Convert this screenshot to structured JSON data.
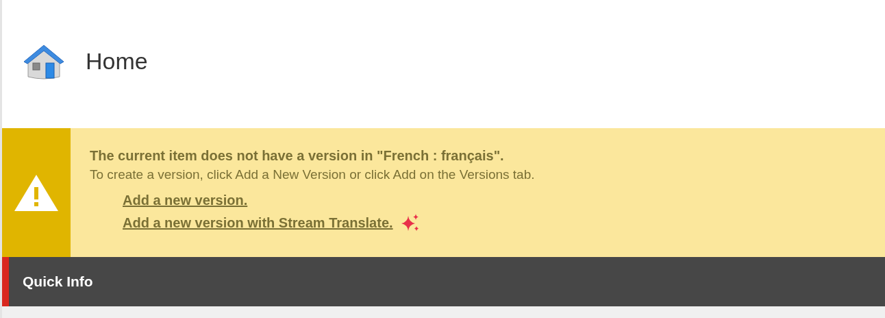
{
  "header": {
    "title": "Home"
  },
  "warning": {
    "title": "The current item does not have a version in \"French : français\".",
    "message": "To create a version, click Add a New Version or click Add on the Versions tab.",
    "links": [
      {
        "label": "Add a new version.",
        "kind": "plain"
      },
      {
        "label": "Add a new version with Stream Translate.",
        "kind": "ai"
      }
    ]
  },
  "section": {
    "title": "Quick Info"
  }
}
